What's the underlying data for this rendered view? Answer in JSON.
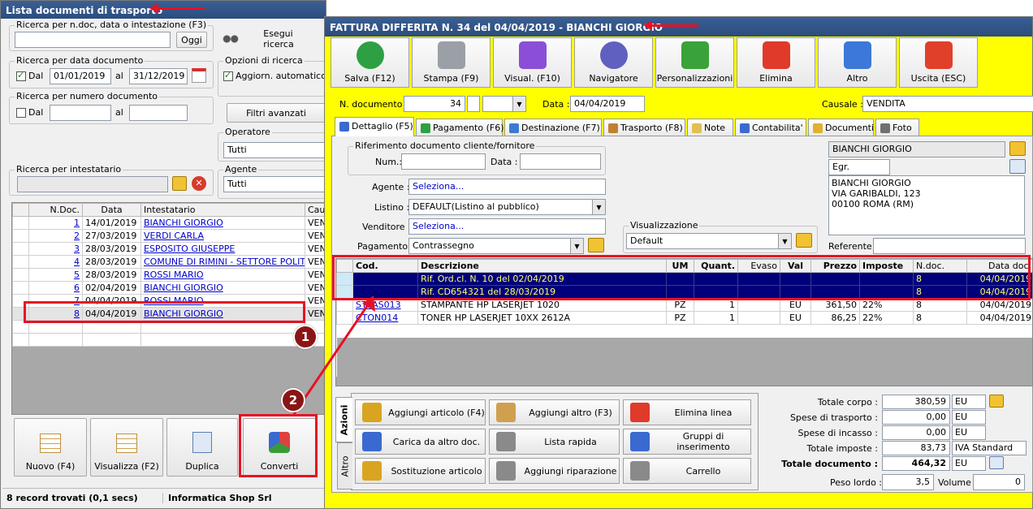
{
  "left": {
    "title": "Lista documenti di trasporto",
    "close_glyph": "✖",
    "search_doc": {
      "legend": "Ricerca per n.doc, data o intestazione (F3)",
      "value": "",
      "btn": "Oggi"
    },
    "exec_search": "Esegui ricerca",
    "search_date": {
      "legend": "Ricerca per data documento",
      "dal_label": "Dal",
      "dal_checked": true,
      "from": "01/01/2019",
      "al_label": "al",
      "to": "31/12/2019"
    },
    "search_num": {
      "legend": "Ricerca per numero documento",
      "dal_label": "Dal",
      "dal_checked": false,
      "al_label": "al"
    },
    "options": {
      "legend": "Opzioni di ricerca",
      "auto_label": "Aggiorn. automatico",
      "auto_checked": true
    },
    "filters_btn": "Filtri avanzati",
    "operatore": {
      "legend": "Operatore",
      "value": "Tutti"
    },
    "agente": {
      "legend": "Agente",
      "value": "Tutti"
    },
    "intestatario": {
      "legend": "Ricerca per intestatario",
      "value": ""
    },
    "table": {
      "headers": [
        "N.Doc.",
        "Data",
        "Intestatario",
        "Caus"
      ],
      "rows": [
        {
          "n": "1",
          "date": "14/01/2019",
          "name": "BIANCHI GIORGIO",
          "caus": "VEND"
        },
        {
          "n": "2",
          "date": "27/03/2019",
          "name": "VERDI CARLA",
          "caus": "VEND"
        },
        {
          "n": "3",
          "date": "28/03/2019",
          "name": "ESPOSITO GIUSEPPE",
          "caus": "VEND"
        },
        {
          "n": "4",
          "date": "28/03/2019",
          "name": "COMUNE DI RIMINI - SETTORE POLIT…",
          "caus": "VEND"
        },
        {
          "n": "5",
          "date": "28/03/2019",
          "name": "ROSSI MARIO",
          "caus": "VEND"
        },
        {
          "n": "6",
          "date": "02/04/2019",
          "name": "BIANCHI GIORGIO",
          "caus": "VEND"
        },
        {
          "n": "7",
          "date": "04/04/2019",
          "name": "ROSSI MARIO",
          "caus": "VEND"
        },
        {
          "n": "8",
          "date": "04/04/2019",
          "name": "BIANCHI GIORGIO",
          "caus": "VEND"
        }
      ]
    },
    "buttons": {
      "nuovo": "Nuovo (F4)",
      "visualizza": "Visualizza (F2)",
      "duplica": "Duplica",
      "converti": "Converti"
    },
    "status": {
      "records": "8 record trovati (0,1 secs)",
      "company": "Informatica Shop Srl"
    }
  },
  "right": {
    "title": "FATTURA DIFFERITA N. 34 del 04/04/2019 - BIANCHI GIORGIO",
    "toolbar": [
      "Salva (F12)",
      "Stampa (F9)",
      "Visual. (F10)",
      "Navigatore",
      "Personalizzazioni",
      "Elimina",
      "Altro",
      "Uscita (ESC)"
    ],
    "ndoc_label": "N. documento :",
    "ndoc_value": "34",
    "data_label": "Data :",
    "data_value": "04/04/2019",
    "causale_label": "Causale :",
    "causale_value": "VENDITA",
    "tabs": [
      "Dettaglio (F5)",
      "Pagamento (F6)",
      "Destinazione (F7)",
      "Trasporto (F8)",
      "Note",
      "Contabilita'",
      "Documenti",
      "Foto"
    ],
    "rif_legend": "Riferimento documento cliente/fornitore",
    "num_label": "Num.:",
    "data2_label": "Data :",
    "agente_label": "Agente :",
    "agente_value": "Seleziona...",
    "listino_label": "Listino :",
    "listino_value": "DEFAULT(Listino al pubblico)",
    "venditore_label": "Venditore :",
    "venditore_value": "Seleziona...",
    "pagamento_label": "Pagamento :",
    "pagamento_value": "Contrassegno",
    "visual_legend": "Visualizzazione",
    "visual_value": "Default",
    "customer_name": "BIANCHI GIORGIO",
    "title_value": "Egr.",
    "address_lines": [
      "BIANCHI GIORGIO",
      "VIA GARIBALDI, 123",
      "00100 ROMA (RM)"
    ],
    "referente_label": "Referente",
    "rows_table": {
      "headers": [
        "Cod.",
        "Descrizione",
        "UM",
        "Quant.",
        "Evaso",
        "Val",
        "Prezzo",
        "Imposte",
        "N.doc.",
        "Data doc."
      ],
      "rows": [
        {
          "cod": "",
          "desc": "Rif. Ord.cl. N. 10 del 02/04/2019",
          "um": "",
          "qty": "",
          "evaso": "",
          "val": "",
          "price": "",
          "tax": "",
          "ndoc": "8",
          "date": "04/04/2019"
        },
        {
          "cod": "",
          "desc": "Rif. CD654321 del 28/03/2019",
          "um": "",
          "qty": "",
          "evaso": "",
          "val": "",
          "price": "",
          "tax": "",
          "ndoc": "8",
          "date": "04/04/2019"
        },
        {
          "cod": "STLAS013",
          "desc": "STAMPANTE HP LASERJET 1020",
          "um": "PZ",
          "qty": "1",
          "evaso": "",
          "val": "EU",
          "price": "361,50",
          "tax": "22%",
          "ndoc": "8",
          "date": "04/04/2019"
        },
        {
          "cod": "CTON014",
          "desc": "TONER HP LASERJET 10XX 2612A",
          "um": "PZ",
          "qty": "1",
          "evaso": "",
          "val": "EU",
          "price": "86,25",
          "tax": "22%",
          "ndoc": "8",
          "date": "04/04/2019"
        }
      ]
    },
    "side_tabs": [
      "Azioni",
      "Altro"
    ],
    "actions": [
      "Aggiungi articolo (F4)",
      "Aggiungi altro (F3)",
      "Elimina linea",
      "Carica da altro doc.",
      "Lista rapida",
      "Gruppi di inserimento",
      "Sostituzione articolo",
      "Aggiungi riparazione",
      "Carrello"
    ],
    "totals": [
      {
        "label": "Totale corpo :",
        "value": "380,59",
        "unit": "EU"
      },
      {
        "label": "Spese di trasporto :",
        "value": "0,00",
        "unit": "EU"
      },
      {
        "label": "Spese di incasso :",
        "value": "0,00",
        "unit": "EU"
      },
      {
        "label": "Totale imposte :",
        "value": "83,73",
        "unit": "IVA Standard"
      },
      {
        "label": "Totale documento :",
        "value": "464,32",
        "unit": "EU"
      }
    ],
    "peso_label": "Peso lordo :",
    "peso_value": "3,5",
    "volume_label": "Volume :",
    "volume_value": "0"
  },
  "annotations": {
    "badge1": "1",
    "badge2": "2"
  },
  "colors": {
    "accent_yellow": "#ffff00",
    "title_blue": "#2b4c7e",
    "sel_row": "#00007a",
    "sel_text": "#ffff66",
    "highlight_red": "#e81123"
  }
}
